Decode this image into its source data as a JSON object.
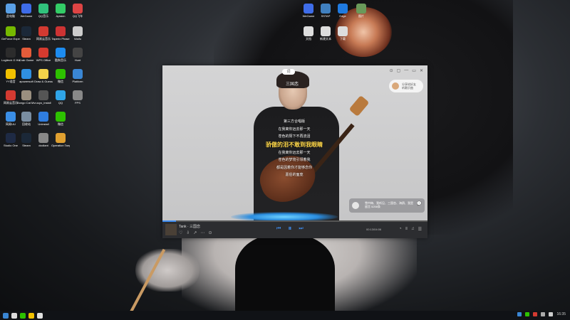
{
  "desktop": {
    "icons": [
      {
        "label": "此电脑",
        "color": "#5aa0e6"
      },
      {
        "label": "GeForce Experience",
        "color": "#76b900"
      },
      {
        "label": "Logitech G HUB",
        "color": "#2c2c2c"
      },
      {
        "label": "YY语音",
        "color": "#f2c100"
      },
      {
        "label": "网易云音乐",
        "color": "#d33a31"
      },
      {
        "label": "网易UU",
        "color": "#3a8ee6"
      },
      {
        "label": "Studio One",
        "color": "#1e2a44"
      },
      {
        "label": "WeGame",
        "color": "#3e6ce8"
      },
      {
        "label": "Steam",
        "color": "#1b2838"
      },
      {
        "label": "Crab Game",
        "color": "#e45c3a"
      },
      {
        "label": "apowersoft",
        "color": "#2f8fe0"
      },
      {
        "label": "Bongo Cat Mver",
        "color": "#9a8f7f"
      },
      {
        "label": "回收站",
        "color": "#7a8ea2"
      },
      {
        "label": "Steam",
        "color": "#1b2838"
      },
      {
        "label": "QQ音乐",
        "color": "#31c27c"
      },
      {
        "label": "网易云音乐",
        "color": "#d33a31"
      },
      {
        "label": "WPS Office",
        "color": "#d53a2f"
      },
      {
        "label": "Draw & Guess",
        "color": "#f3d34a"
      },
      {
        "label": "uuyo_install",
        "color": "#555"
      },
      {
        "label": "Uninstall",
        "color": "#2f7de0"
      },
      {
        "label": "dccliant",
        "color": "#888"
      },
      {
        "label": "Apiskin",
        "color": "#3c6"
      },
      {
        "label": "Taperix Phase",
        "color": "#c33"
      },
      {
        "label": "酷狗音乐",
        "color": "#1d8cf0"
      },
      {
        "label": "微信",
        "color": "#2dc100"
      },
      {
        "label": "QQ",
        "color": "#2fa4e7"
      },
      {
        "label": "微信",
        "color": "#2dc100"
      },
      {
        "label": "Operation Tango",
        "color": "#e0a030"
      },
      {
        "label": "QQ飞车",
        "color": "#d44"
      },
      {
        "label": "Waifu",
        "color": "#ccc"
      },
      {
        "label": "Hunt",
        "color": "#444"
      },
      {
        "label": "Platform",
        "color": "#3a86d4"
      },
      {
        "label": "FPS",
        "color": "#888"
      }
    ],
    "right_icons": [
      {
        "label": "WeGame",
        "color": "#3e6ce8"
      },
      {
        "label": "SSTAP",
        "color": "#4080c0"
      },
      {
        "label": "Edge",
        "color": "#1f7ae0"
      },
      {
        "label": "图片",
        "color": "#6a9a5a"
      },
      {
        "label": "文档",
        "color": "#ddd"
      },
      {
        "label": "新建文本",
        "color": "#ddd"
      },
      {
        "label": "下载",
        "color": "#ddd"
      }
    ]
  },
  "player": {
    "lyric_toggle": "词",
    "song_title": "三国恋",
    "window_controls": [
      "⊙",
      "▢",
      "—",
      "▭",
      "✕"
    ],
    "share_chip": {
      "line1": "分享给好友",
      "line2": "听歌识曲"
    },
    "lyrics": [
      "第三方合唱版",
      "在我离你远去那一天",
      "苍色的阳下不再流泪",
      "骄傲的泪不敢到我眼睛",
      "在我离你远去那一天",
      "苍色的梦境引领着我",
      "都是因着你才能够念你",
      "嘉伯的面庞"
    ],
    "current_lyric_index": 3,
    "comment_chip": {
      "line1": "雪中梅、我听见、三国恋、海鸥、我是",
      "line2": "留言 5258条"
    },
    "track_name": "Tank · 三国恋",
    "track_tools": [
      "♡",
      "⇩",
      "↗",
      "⋯",
      "⊙"
    ],
    "controls": {
      "prev": "⏮",
      "play": "⏸",
      "next": "⏭"
    },
    "time": "00:13/04:06",
    "right_tools": [
      "◔",
      "≡",
      "♫",
      "☰"
    ],
    "progress": 0.05
  },
  "taskbar": {
    "left_icons": [
      "#3a86d4",
      "#ddd",
      "#2dc100",
      "#f2c100",
      "#e0e0e0"
    ],
    "tray_time": "16:35",
    "tray_icons": [
      "#3a86d4",
      "#2dc100",
      "#d33a31",
      "#aaa",
      "#ccc",
      "#ccc"
    ]
  }
}
